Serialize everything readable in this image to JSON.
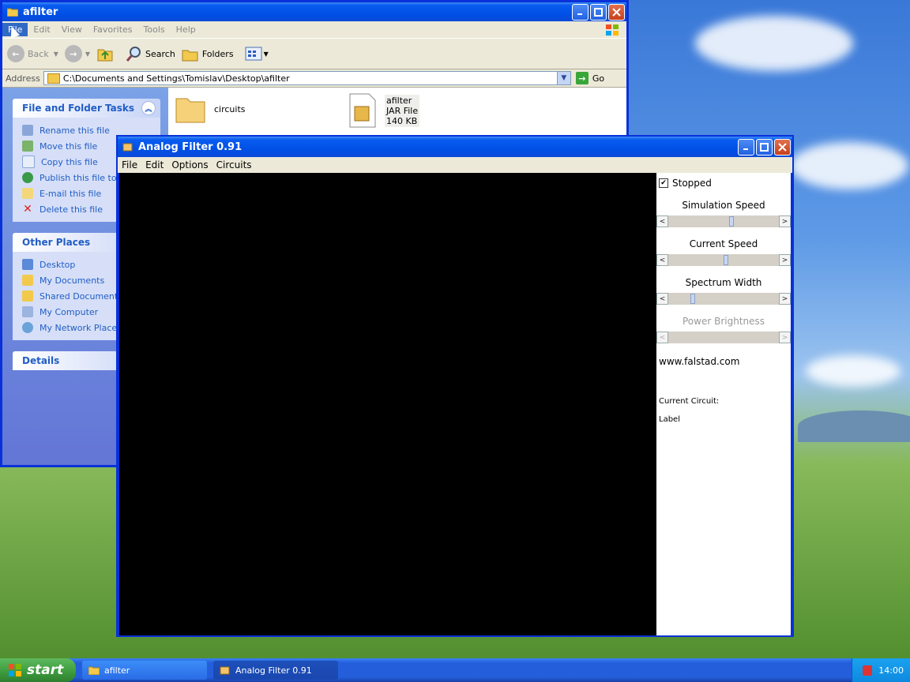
{
  "explorer": {
    "title": "afilter",
    "menu": [
      "File",
      "Edit",
      "View",
      "Favorites",
      "Tools",
      "Help"
    ],
    "toolbar": {
      "back": "Back",
      "search": "Search",
      "folders": "Folders"
    },
    "address": {
      "label": "Address",
      "value": "C:\\Documents and Settings\\Tomislav\\Desktop\\afilter",
      "go": "Go"
    },
    "tasks": {
      "title": "File and Folder Tasks",
      "items": [
        "Rename this file",
        "Move this file",
        "Copy this file",
        "Publish this file to th",
        "E-mail this file",
        "Delete this file"
      ]
    },
    "places": {
      "title": "Other Places",
      "items": [
        "Desktop",
        "My Documents",
        "Shared Documents",
        "My Computer",
        "My Network Places"
      ]
    },
    "details": {
      "title": "Details"
    },
    "files": [
      {
        "name": "circuits"
      },
      {
        "name": "afilter",
        "type": "JAR File",
        "size": "140 KB"
      }
    ]
  },
  "afilter": {
    "title": "Analog Filter 0.91",
    "menu": [
      "File",
      "Edit",
      "Options",
      "Circuits"
    ],
    "stopped": "Stopped",
    "sliders": [
      {
        "label": "Simulation Speed",
        "value": 0.55,
        "enabled": true
      },
      {
        "label": "Current Speed",
        "value": 0.5,
        "enabled": true
      },
      {
        "label": "Spectrum Width",
        "value": 0.2,
        "enabled": true
      },
      {
        "label": "Power Brightness",
        "value": 0.0,
        "enabled": false
      }
    ],
    "site": "www.falstad.com",
    "current_circuit": "Current Circuit:",
    "label": "Label"
  },
  "taskbar": {
    "start": "start",
    "tasks": [
      "afilter",
      "Analog Filter 0.91"
    ],
    "clock": "14:00"
  }
}
